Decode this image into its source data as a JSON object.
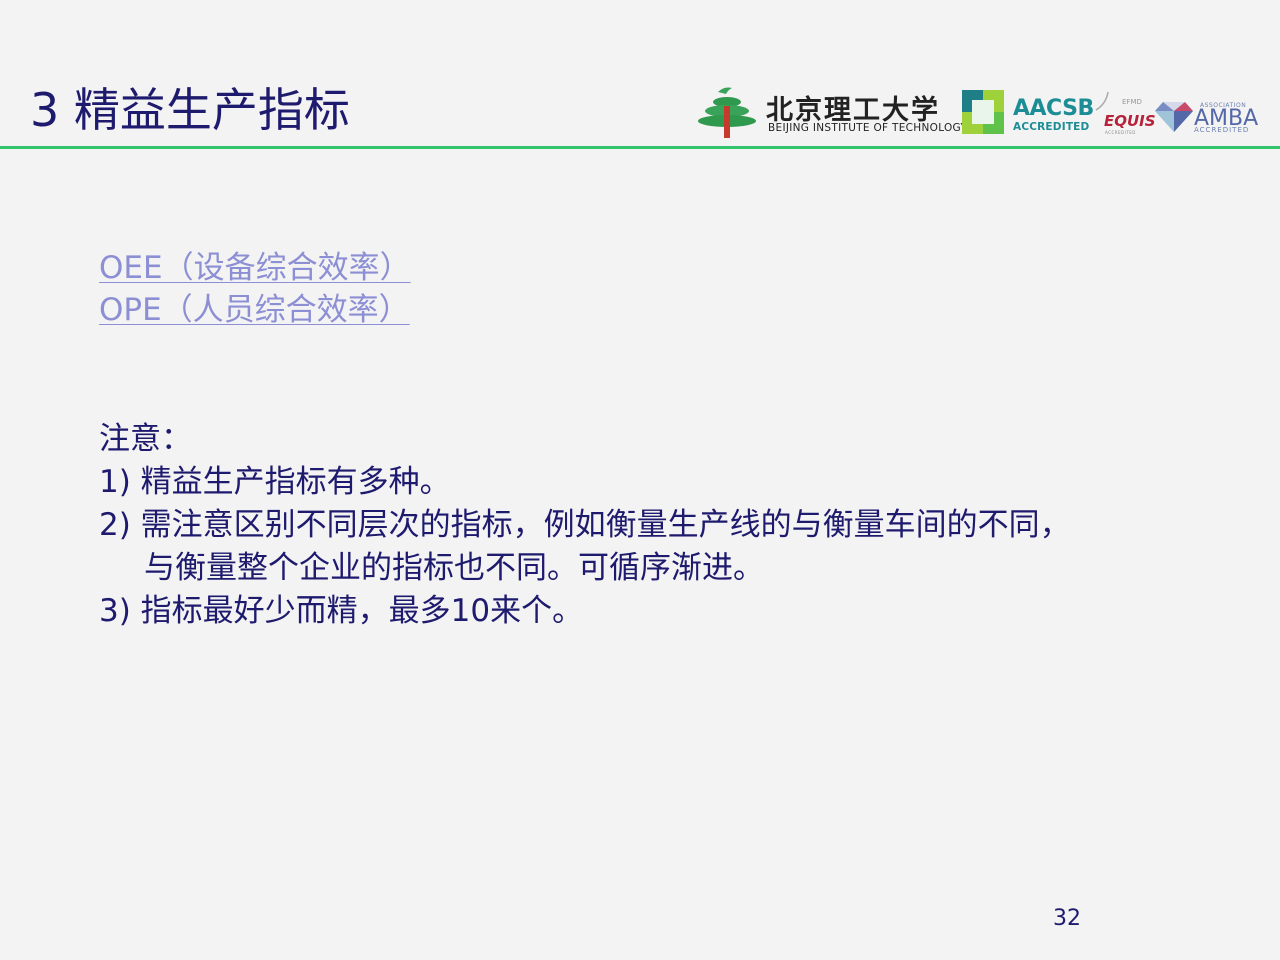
{
  "slide": {
    "title": "3 精益生产指标",
    "page_number": "32"
  },
  "logos": {
    "bit_name_cn": "北京理工大学",
    "bit_name_en": "BEIJING INSTITUTE OF TECHNOLOGY",
    "aacsb": "AACSB",
    "aacsb_sub": "ACCREDITED",
    "efmd": "EFMD",
    "equis": "EQUIS",
    "equis_sub": "ACCREDITED",
    "amba_assoc": "ASSOCIATION",
    "amba": "AMBA",
    "amba_sub": "ACCREDITED"
  },
  "links": [
    {
      "label": "OEE（设备综合效率）"
    },
    {
      "label": "OPE（人员综合效率）"
    }
  ],
  "notes": {
    "heading": "注意：",
    "item1": "1) 精益生产指标有多种。",
    "item2_line1": "2) 需注意区别不同层次的指标，例如衡量生产线的与衡量车间的不同，",
    "item2_line2": "与衡量整个企业的指标也不同。可循序渐进。",
    "item3": "3) 指标最好少而精，最多10来个。"
  },
  "colors": {
    "title": "#1e1a6e",
    "link": "#8c8fd4",
    "rule": "#33c46e",
    "aacsb": "#1c8d95",
    "equis": "#b5223a",
    "amba": "#5468a8"
  }
}
